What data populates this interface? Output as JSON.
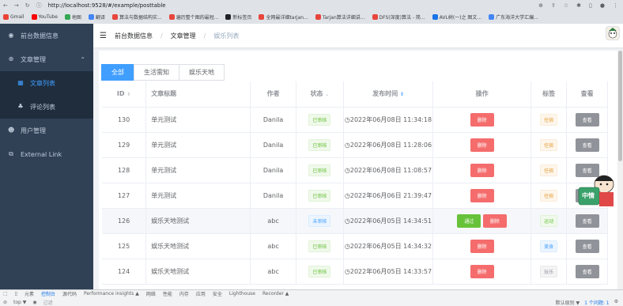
{
  "browser": {
    "url": "http://localhost:9528/#/example/posttable",
    "bookmarks": [
      "Gmail",
      "YouTube",
      "地图",
      "翻译",
      "算法与数据结构实...",
      "遍历整个图的最短...",
      "新标签页",
      "全网最详细tarjan...",
      "Tarjan算法详细讲...",
      "DFS(深度)算法 - 简...",
      "AVL树(一)之 图文...",
      "广东海洋大学汇编..."
    ],
    "bookmark_colors": [
      "#ea4335",
      "#ff0000",
      "#34a853",
      "#4285f4",
      "#e8453c",
      "#e8453c",
      "#202124",
      "#e8453c",
      "#e8453c",
      "#e8453c",
      "#1a73e8",
      "#4285f4"
    ]
  },
  "sidebar": {
    "items": [
      {
        "label": "前台数据信息",
        "icon": "dashboard-icon"
      },
      {
        "label": "文章管理",
        "icon": "plus-circle-icon",
        "arrow": "chevron-up-icon"
      },
      {
        "label": "文章列表",
        "icon": "grid-icon",
        "active": true
      },
      {
        "label": "评论列表",
        "icon": "tree-icon"
      },
      {
        "label": "用户管理",
        "icon": "users-icon"
      },
      {
        "label": "External Link",
        "icon": "external-link-icon"
      }
    ]
  },
  "navbar": {
    "breadcrumb": [
      "前台数据信息",
      "文章管理",
      "娱乐列表"
    ]
  },
  "tabs": [
    "全部",
    "生活需知",
    "娱乐天地"
  ],
  "table": {
    "headers": {
      "id": "ID",
      "title": "文章标题",
      "author": "作者",
      "status": "状态",
      "time": "发布时间",
      "action": "操作",
      "tag": "标签",
      "view": "查看"
    },
    "rows": [
      {
        "id": "130",
        "title": "单元测试",
        "author": "Danila",
        "status": "已审核",
        "time": "2022年06月08日 11:34:18",
        "del": "删除",
        "tag": "任宿",
        "view": "查看"
      },
      {
        "id": "129",
        "title": "单元测试",
        "author": "Danila",
        "status": "已审核",
        "time": "2022年06月08日 11:28:06",
        "del": "删除",
        "tag": "任宿",
        "view": "查看"
      },
      {
        "id": "128",
        "title": "单元测试",
        "author": "Danila",
        "status": "已审核",
        "time": "2022年06月08日 11:08:57",
        "del": "删除",
        "tag": "任宿",
        "view": "查看"
      },
      {
        "id": "127",
        "title": "单元测试",
        "author": "Danila",
        "status": "已审核",
        "time": "2022年06月06日 21:39:47",
        "del": "删除",
        "tag": "任宿",
        "view": "查看"
      },
      {
        "id": "126",
        "title": "娱乐天地测试",
        "author": "abc",
        "status": "未审核",
        "time": "2022年06月05日 14:34:51",
        "pass": "通过",
        "del": "删除",
        "tag": "运动",
        "view": "查看"
      },
      {
        "id": "125",
        "title": "娱乐天地测试",
        "author": "abc",
        "status": "已审核",
        "time": "2022年06月05日 14:34:32",
        "del": "删除",
        "tag": "美食",
        "view": "查看"
      },
      {
        "id": "124",
        "title": "娱乐天地测试",
        "author": "abc",
        "status": "已审核",
        "time": "2022年06月05日 14:33:57",
        "del": "删除",
        "tag": "玩乐",
        "view": "查看"
      }
    ]
  },
  "devtools": {
    "tabs": [
      "元素",
      "控制台",
      "源代码",
      "Performance insights ▲",
      "网络",
      "性能",
      "内存",
      "应用",
      "安全",
      "Lighthouse",
      "Recorder ▲"
    ],
    "active_tab": "控制台",
    "filter_label": "top ▼",
    "filter_placeholder": "过滤",
    "levels": "默认级别 ▼",
    "issues": "1 个问题: 1"
  },
  "mascot": {
    "label": "中情"
  }
}
